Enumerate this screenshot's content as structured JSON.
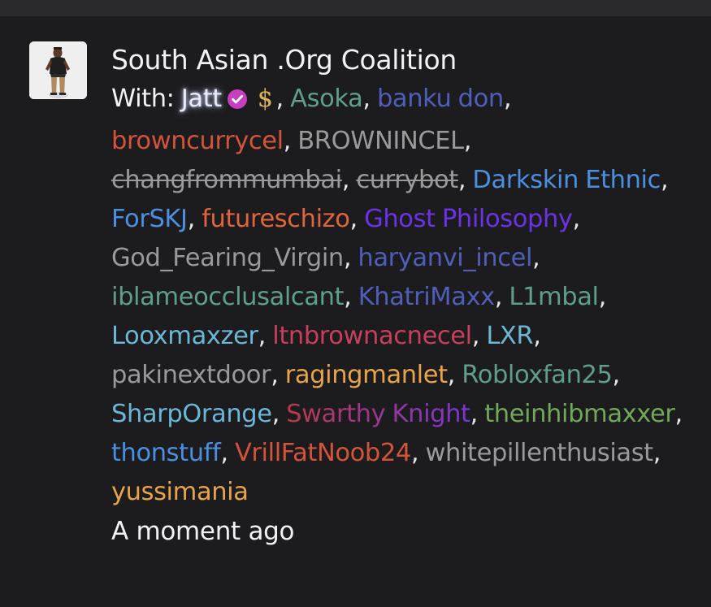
{
  "conversation": {
    "title": "South Asian .Org Coalition",
    "with_label": "With:",
    "owner": {
      "name": "Jatt",
      "color": "#e8eaff",
      "badges": [
        "verified-check-icon",
        "dollar-icon"
      ]
    },
    "members": [
      {
        "name": "Asoka",
        "color": "#5f9e8c"
      },
      {
        "name": "banku don",
        "color": "#4f5fb8"
      },
      {
        "name": "browncurrycel",
        "color": "#d4533b"
      },
      {
        "name": "BROWNINCEL",
        "color": "#9a9a9a"
      },
      {
        "name": "changfrommumbai",
        "color": "#9a9a9a",
        "strikethrough": true
      },
      {
        "name": "currybot",
        "color": "#9a9a9a",
        "strikethrough": true
      },
      {
        "name": "Darkskin Ethnic",
        "color": "#4b8fe0"
      },
      {
        "name": "ForSKJ",
        "color": "#4b8fe0"
      },
      {
        "name": "futureschizo",
        "color": "#e0643c"
      },
      {
        "name": "Ghost Philosophy",
        "color": "#6a34e6"
      },
      {
        "name": "God_Fearing_Virgin",
        "color": "#9a9a9a"
      },
      {
        "name": "haryanvi_incel",
        "color": "#4f5fb8"
      },
      {
        "name": "iblameocclusalcant",
        "color": "#5f9e8c"
      },
      {
        "name": "KhatriMaxx",
        "color": "#4f5fb8"
      },
      {
        "name": "L1mbal",
        "color": "#5f9e8c"
      },
      {
        "name": "Looxmaxzer",
        "color": "#6cb7d6"
      },
      {
        "name": "ltnbrownacnecel",
        "color": "#c83f5e"
      },
      {
        "name": "LXR",
        "color": "#6cb7d6"
      },
      {
        "name": "pakinextdoor",
        "color": "#9a9a9a"
      },
      {
        "name": "ragingmanlet",
        "color": "#e8a44a"
      },
      {
        "name": "Robloxfan25",
        "color": "#5f9e8c"
      },
      {
        "name": "SharpOrange",
        "color": "#6cb7d6"
      },
      {
        "name": "Swarthy Knight",
        "color": "#b63a4a",
        "color_end": "#7a36d8"
      },
      {
        "name": "theinhibmaxxer",
        "color": "#72a85a"
      },
      {
        "name": "thonstuff",
        "color": "#4b8fe0"
      },
      {
        "name": "VrillFatNoob24",
        "color": "#d4533b"
      },
      {
        "name": "whitepillenthusiast",
        "color": "#9a9a9a"
      },
      {
        "name": "yussimania",
        "color": "#e8a44a"
      }
    ],
    "timestamp": "A moment ago"
  },
  "colors": {
    "background": "#1c1c1e",
    "topbar": "#2a2a2d",
    "text": "#f2f2f2",
    "verified_badge": "#c63fc0"
  }
}
